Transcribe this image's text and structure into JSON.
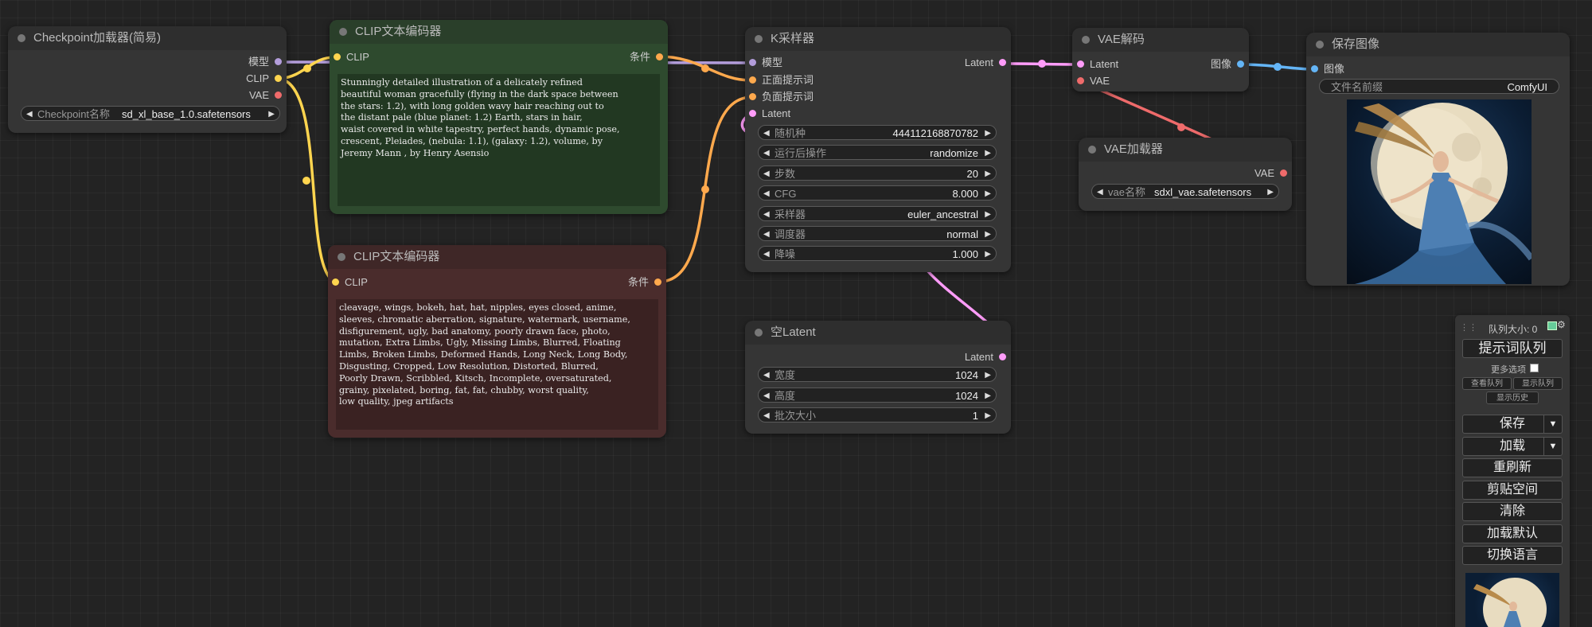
{
  "nodes": {
    "checkpoint": {
      "title": "Checkpoint加载器(简易)",
      "outputs": [
        "模型",
        "CLIP",
        "VAE"
      ],
      "widget": {
        "label": "Checkpoint名称",
        "value": "sd_xl_base_1.0.safetensors"
      }
    },
    "clip_pos": {
      "title": "CLIP文本编码器",
      "input": "CLIP",
      "output": "条件",
      "text": "Stunningly detailed illustration of a delicately refined\nbeautiful woman gracefully (flying in the dark space between\nthe stars: 1.2), with long golden wavy hair reaching out to\nthe distant pale (blue planet: 1.2) Earth, stars in hair,\nwaist covered in white tapestry, perfect hands, dynamic pose,\ncrescent, Pleiades, (nebula: 1.1), (galaxy: 1.2), volume, by\nJeremy Mann , by Henry Asensio"
    },
    "clip_neg": {
      "title": "CLIP文本编码器",
      "input": "CLIP",
      "output": "条件",
      "text": "cleavage, wings, bokeh, hat, hat, nipples, eyes closed, anime,\nsleeves, chromatic aberration, signature, watermark, username,\ndisfigurement, ugly, bad anatomy, poorly drawn face, photo,\nmutation, Extra Limbs, Ugly, Missing Limbs, Blurred, Floating\nLimbs, Broken Limbs, Deformed Hands, Long Neck, Long Body,\nDisgusting, Cropped, Low Resolution, Distorted, Blurred,\nPoorly Drawn, Scribbled, Kitsch, Incomplete, oversaturated,\ngrainy, pixelated, boring, fat, fat, chubby, worst quality,\nlow quality, jpeg artifacts"
    },
    "ksampler": {
      "title": "K采样器",
      "inputs": [
        "模型",
        "正面提示词",
        "负面提示词",
        "Latent"
      ],
      "output": "Latent",
      "widgets": [
        {
          "label": "随机种",
          "value": "444112168870782"
        },
        {
          "label": "运行后操作",
          "value": "randomize"
        },
        {
          "label": "步数",
          "value": "20"
        },
        {
          "label": "CFG",
          "value": "8.000"
        },
        {
          "label": "采样器",
          "value": "euler_ancestral"
        },
        {
          "label": "调度器",
          "value": "normal"
        },
        {
          "label": "降噪",
          "value": "1.000"
        }
      ]
    },
    "empty_latent": {
      "title": "空Latent",
      "output": "Latent",
      "widgets": [
        {
          "label": "宽度",
          "value": "1024"
        },
        {
          "label": "高度",
          "value": "1024"
        },
        {
          "label": "批次大小",
          "value": "1"
        }
      ]
    },
    "vae_decode": {
      "title": "VAE解码",
      "inputs": [
        "Latent",
        "VAE"
      ],
      "output": "图像"
    },
    "vae_loader": {
      "title": "VAE加载器",
      "output": "VAE",
      "widget": {
        "label": "vae名称",
        "value": "sdxl_vae.safetensors"
      }
    },
    "save_image": {
      "title": "保存图像",
      "input": "图像",
      "widget": {
        "label": "文件名前缀",
        "value": "ComfyUI"
      }
    }
  },
  "menu": {
    "queue_size": "队列大小: 0",
    "queue_prompt": "提示词队列",
    "extra_options": "更多选项",
    "view_queue": "查看队列",
    "view_history": "显示历史",
    "show_queue": "显示队列",
    "save": "保存",
    "load": "加载",
    "refresh": "重刷新",
    "clipspace": "剪贴空间",
    "clear": "清除",
    "load_default": "加载默认",
    "switch_locale": "切换语言"
  },
  "colors": {
    "model": "#b39ddb",
    "clip": "#ffd54f",
    "vae": "#ef6b6b",
    "conditioning": "#ffa94d",
    "latent": "#ff9cf9",
    "image": "#64b5f6",
    "positive_node": "#2e4a2e",
    "negative_node": "#4a2c2c"
  },
  "icons": {
    "collapse_dot": "circle-dot-icon",
    "arrow_left": "triangle-left-icon",
    "arrow_right": "triangle-right-icon",
    "dropdown": "caret-down-icon",
    "drag": "drag-handle-icon",
    "settings": "gear-icon"
  }
}
